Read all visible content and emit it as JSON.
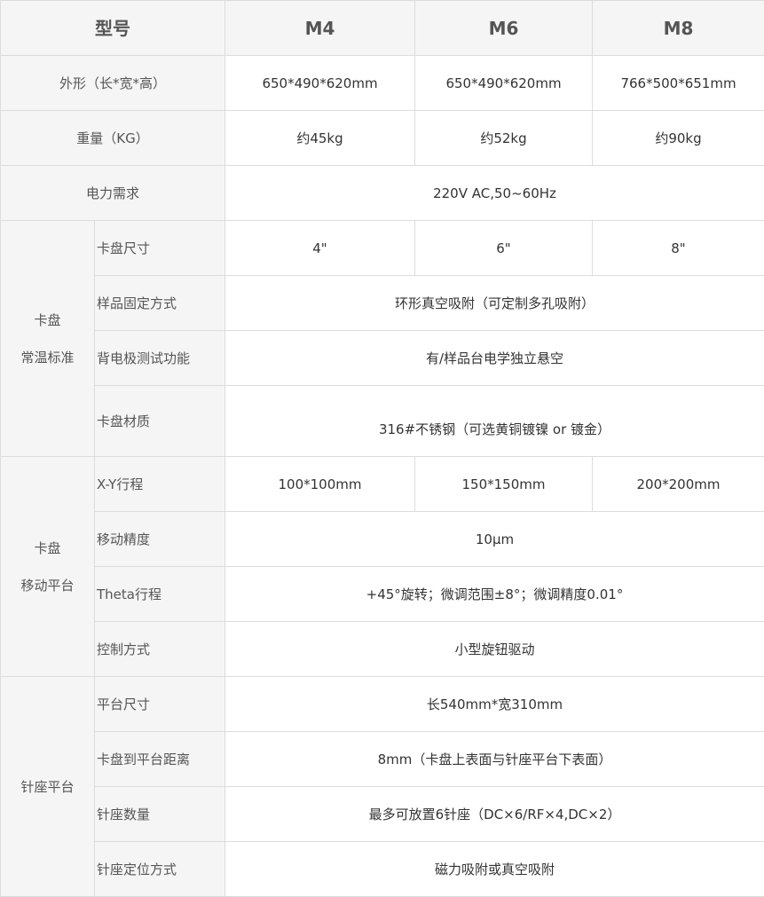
{
  "header": {
    "model_label": "型号",
    "models": [
      "M4",
      "M6",
      "M8"
    ]
  },
  "rows": {
    "dimensions": {
      "label": "外形（长*宽*高）",
      "values": [
        "650*490*620mm",
        "650*490*620mm",
        "766*500*651mm"
      ]
    },
    "weight": {
      "label": "重量（KG）",
      "values": [
        "约45kg",
        "约52kg",
        "约90kg"
      ]
    },
    "power": {
      "label": "电力需求",
      "value": "220V AC,50~60Hz"
    }
  },
  "groups": {
    "chuck_std": {
      "label_line1": "卡盘",
      "label_line2": "常温标准",
      "rows": [
        {
          "label": "卡盘尺寸",
          "values": [
            "4\"",
            "6\"",
            "8\""
          ]
        },
        {
          "label": "样品固定方式",
          "value": "环形真空吸附（可定制多孔吸附）"
        },
        {
          "label": "背电极测试功能",
          "value": "有/样品台电学独立悬空"
        },
        {
          "label": "卡盘材质",
          "value": "316#不锈钢（可选黄铜镀镍 or 镀金）"
        }
      ]
    },
    "chuck_move": {
      "label_line1": "卡盘",
      "label_line2": "移动平台",
      "rows": [
        {
          "label": "X-Y行程",
          "values": [
            "100*100mm",
            "150*150mm",
            "200*200mm"
          ]
        },
        {
          "label": "移动精度",
          "value": "10µm"
        },
        {
          "label": "Theta行程",
          "value": "+45°旋转；微调范围±8°；微调精度0.01°"
        },
        {
          "label": "控制方式",
          "value": "小型旋钮驱动"
        }
      ]
    },
    "probe_platform": {
      "label": "针座平台",
      "rows": [
        {
          "label": "平台尺寸",
          "value": "长540mm*宽310mm"
        },
        {
          "label": "卡盘到平台距离",
          "value": "8mm（卡盘上表面与针座平台下表面）"
        },
        {
          "label": "针座数量",
          "value": "最多可放置6针座（DC×6/RF×4,DC×2）"
        },
        {
          "label": "针座定位方式",
          "value": "磁力吸附或真空吸附"
        }
      ]
    }
  }
}
